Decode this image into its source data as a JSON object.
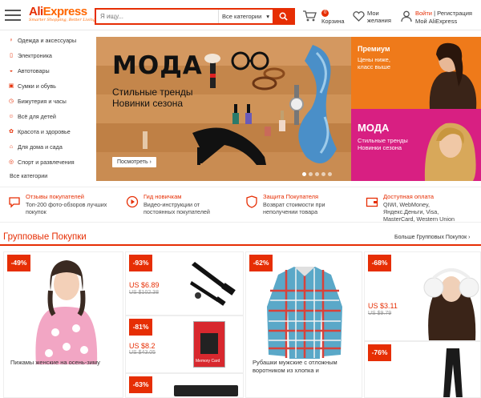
{
  "header": {
    "logo_main_a": "Ali",
    "logo_main_b": "Express",
    "logo_tagline": "Smarter Shopping, Better Living!",
    "search_placeholder": "Я ищу...",
    "search_category": "Все категории",
    "cart_count": "0",
    "cart_label": "Корзина",
    "wishlist_label": "Мои желания",
    "login": "Войти",
    "separator": "|",
    "register": "Регистрация",
    "my_account": "Мой AliExpress"
  },
  "sidebar": {
    "items": [
      {
        "label": "Одежда и аксессуары",
        "icon": "dress-icon"
      },
      {
        "label": "Электроника",
        "icon": "phone-icon"
      },
      {
        "label": "Автотовары",
        "icon": "car-icon"
      },
      {
        "label": "Сумки и обувь",
        "icon": "bag-icon"
      },
      {
        "label": "Бижутерия и часы",
        "icon": "watch-icon"
      },
      {
        "label": "Всё для детей",
        "icon": "baby-icon"
      },
      {
        "label": "Красота и здоровье",
        "icon": "beauty-icon"
      },
      {
        "label": "Для дома и сада",
        "icon": "home-icon"
      },
      {
        "label": "Спорт и развлечения",
        "icon": "sport-icon"
      }
    ],
    "all_categories": "Все категории"
  },
  "banner": {
    "title": "МОДА",
    "subtitle_line1": "Стильные тренды",
    "subtitle_line2": "Новинки сезона",
    "cta": "Посмотреть",
    "slides": 5,
    "active_slide": 1
  },
  "promos": [
    {
      "title": "Премиум",
      "line1": "Цены ниже,",
      "line2": "класс выше",
      "color": "#ef7a1a"
    },
    {
      "title": "МОДА",
      "line1": "Стильные тренды",
      "line2": "Новинки сезона",
      "color": "#d81f82"
    }
  ],
  "features": [
    {
      "title": "Отзывы покупателей",
      "desc": "Топ-200 фото-обзоров лучших покупок",
      "icon": "chat-icon"
    },
    {
      "title": "Гид новичкам",
      "desc": "Видео-инструкции от постоянных покупателей",
      "icon": "play-icon"
    },
    {
      "title": "Защита Покупателя",
      "desc": "Возврат стоимости при неполучении товара",
      "icon": "shield-icon"
    },
    {
      "title": "Доступная оплата",
      "desc": "QIWI, WebMoney, Яндекс.Деньги, Visa, MasterCard, Western Union",
      "icon": "wallet-icon"
    }
  ],
  "section": {
    "title": "Групповые Покупки",
    "more": "Больше Групповых Покупок"
  },
  "products": [
    {
      "discount": "-49%",
      "name": "Пижамы женские на осень-зиму"
    },
    {
      "discount": "-93%",
      "price": "US $6.89",
      "old_price": "US $102.38"
    },
    {
      "discount": "-81%",
      "price": "US $8.2",
      "old_price": "US $43.05"
    },
    {
      "discount": "-63%"
    },
    {
      "discount": "-62%",
      "name": "Рубашки мужские с отложным воротником из хлопка и"
    },
    {
      "discount": "-68%",
      "price": "US $3.11",
      "old_price": "US $9.79"
    },
    {
      "discount": "-76%"
    }
  ],
  "memory_card_label": "Memory Card",
  "colors": {
    "brand": "#e62e04",
    "accent": "#f60",
    "promo_orange": "#ef7a1a",
    "promo_pink": "#d81f82"
  }
}
